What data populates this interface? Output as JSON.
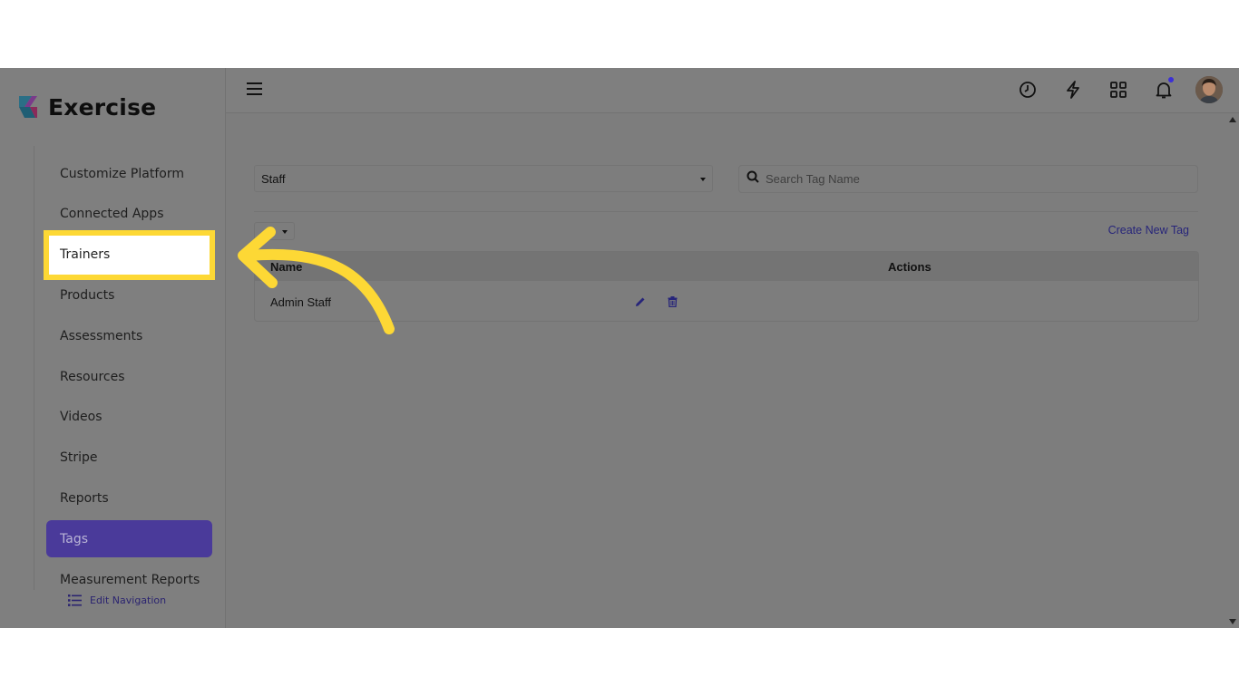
{
  "brand": {
    "name": "Exercise"
  },
  "sidebar": {
    "items": [
      {
        "label": "Customize Platform"
      },
      {
        "label": "Connected Apps"
      },
      {
        "label": "Trainers"
      },
      {
        "label": "Products"
      },
      {
        "label": "Assessments"
      },
      {
        "label": "Resources"
      },
      {
        "label": "Videos"
      },
      {
        "label": "Stripe"
      },
      {
        "label": "Reports"
      },
      {
        "label": "Tags"
      },
      {
        "label": "Measurement Reports"
      }
    ],
    "active_item": "Tags",
    "highlighted_item": "Trainers",
    "edit_navigation_label": "Edit Navigation"
  },
  "topbar": {
    "icons": [
      "history-icon",
      "bolt-icon",
      "apps-grid-icon",
      "bell-icon",
      "avatar"
    ]
  },
  "filters": {
    "type_select": {
      "value": "Staff"
    },
    "search": {
      "placeholder": "Search Tag Name"
    }
  },
  "toolbar": {
    "create_label": "Create New Tag"
  },
  "table": {
    "columns": [
      "Name",
      "Actions"
    ],
    "rows": [
      {
        "name": "Admin Staff",
        "actions": [
          "edit-icon",
          "delete-icon"
        ]
      }
    ]
  },
  "colors": {
    "active_nav": "#4a3a9a",
    "highlight_border": "#fdd835",
    "arrow": "#fdd835",
    "notification_dot": "#3b2fd6"
  }
}
